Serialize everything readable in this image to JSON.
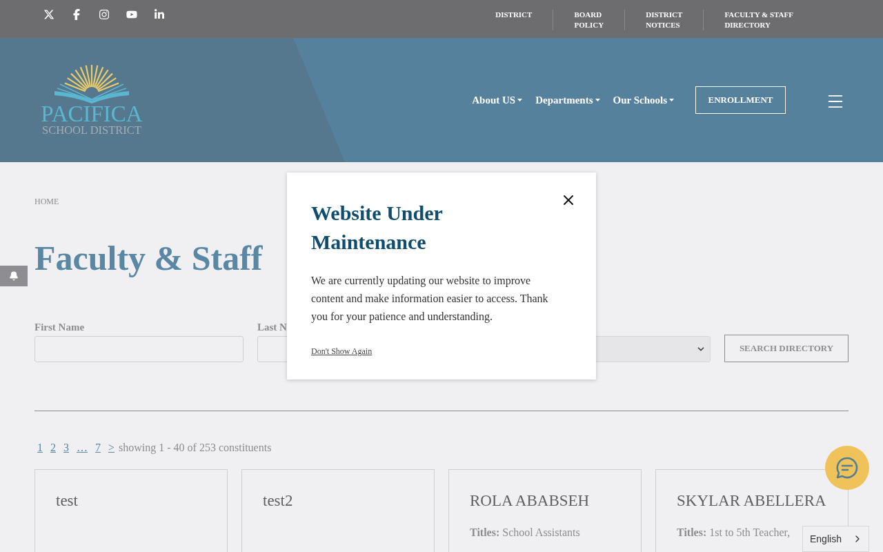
{
  "top_links": [
    "DISTRICT",
    "BOARD\nPOLICY",
    "DISTRICT\nNOTICES",
    "FACULTY & STAFF\nDIRECTORY"
  ],
  "logo": {
    "name": "PACIFICA",
    "subtitle": "SCHOOL DISTRICT"
  },
  "nav": [
    {
      "label": "About US",
      "dropdown": true
    },
    {
      "label": "Departments",
      "dropdown": true
    },
    {
      "label": "Our Schools",
      "dropdown": true
    }
  ],
  "enroll_button": "ENROLLMENT",
  "breadcrumb": "HOME",
  "page_title": "Faculty & Staff",
  "form": {
    "fields": [
      {
        "label": "First Name",
        "kind": "text"
      },
      {
        "label": "Last N",
        "kind": "text"
      },
      {
        "kind": "select"
      }
    ],
    "button": "SEARCH DIRECTORY"
  },
  "pagination": {
    "pages": [
      {
        "label": "1"
      },
      {
        "label": "2"
      },
      {
        "label": "3"
      },
      {
        "label": "…"
      },
      {
        "label": "7"
      },
      {
        "label": ">"
      }
    ],
    "summary": "showing 1 - 40 of 253 constituents"
  },
  "cards": [
    {
      "name": "test"
    },
    {
      "name": "test2"
    },
    {
      "name": "ROLA ABABSEH",
      "titles": "**Titles:** School Assistants"
    },
    {
      "name": "SKYLAR ABELLERA",
      "titles": "**Titles:** 1st to 5th Teacher,"
    }
  ],
  "modal": {
    "title": "Website Under Maintenance",
    "body": "We are currently updating our website to improve content and make information easier to access. Thank you for your patience and understanding.",
    "link": "Don't Show Again"
  },
  "language": "English"
}
